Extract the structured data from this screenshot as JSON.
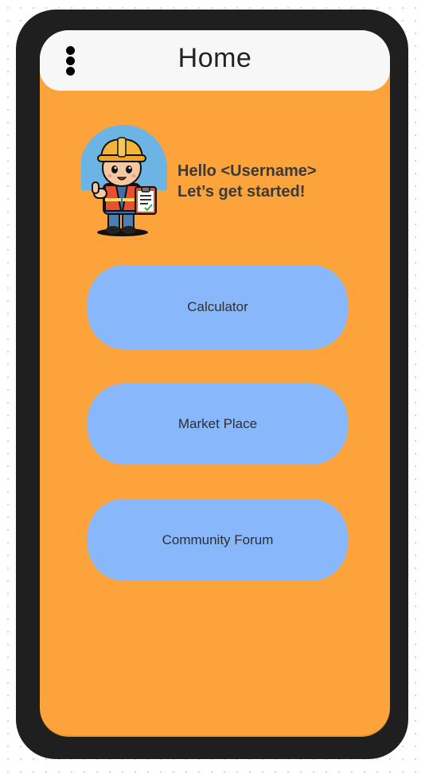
{
  "header": {
    "title": "Home",
    "menu_icon": "more-vertical-icon"
  },
  "greeting": {
    "line1": "Hello <Username>",
    "line2": "Let’s get started!",
    "avatar_icon": "construction-worker-mascot"
  },
  "buttons": [
    {
      "label": "Calculator"
    },
    {
      "label": "Market Place"
    },
    {
      "label": "Community Forum"
    }
  ],
  "colors": {
    "frame": "#1f1f1f",
    "screen_background": "#fda33b",
    "header_background": "#f7f7f7",
    "button_background": "#88b7fb",
    "mascot_circle": "#6cb4e4"
  }
}
